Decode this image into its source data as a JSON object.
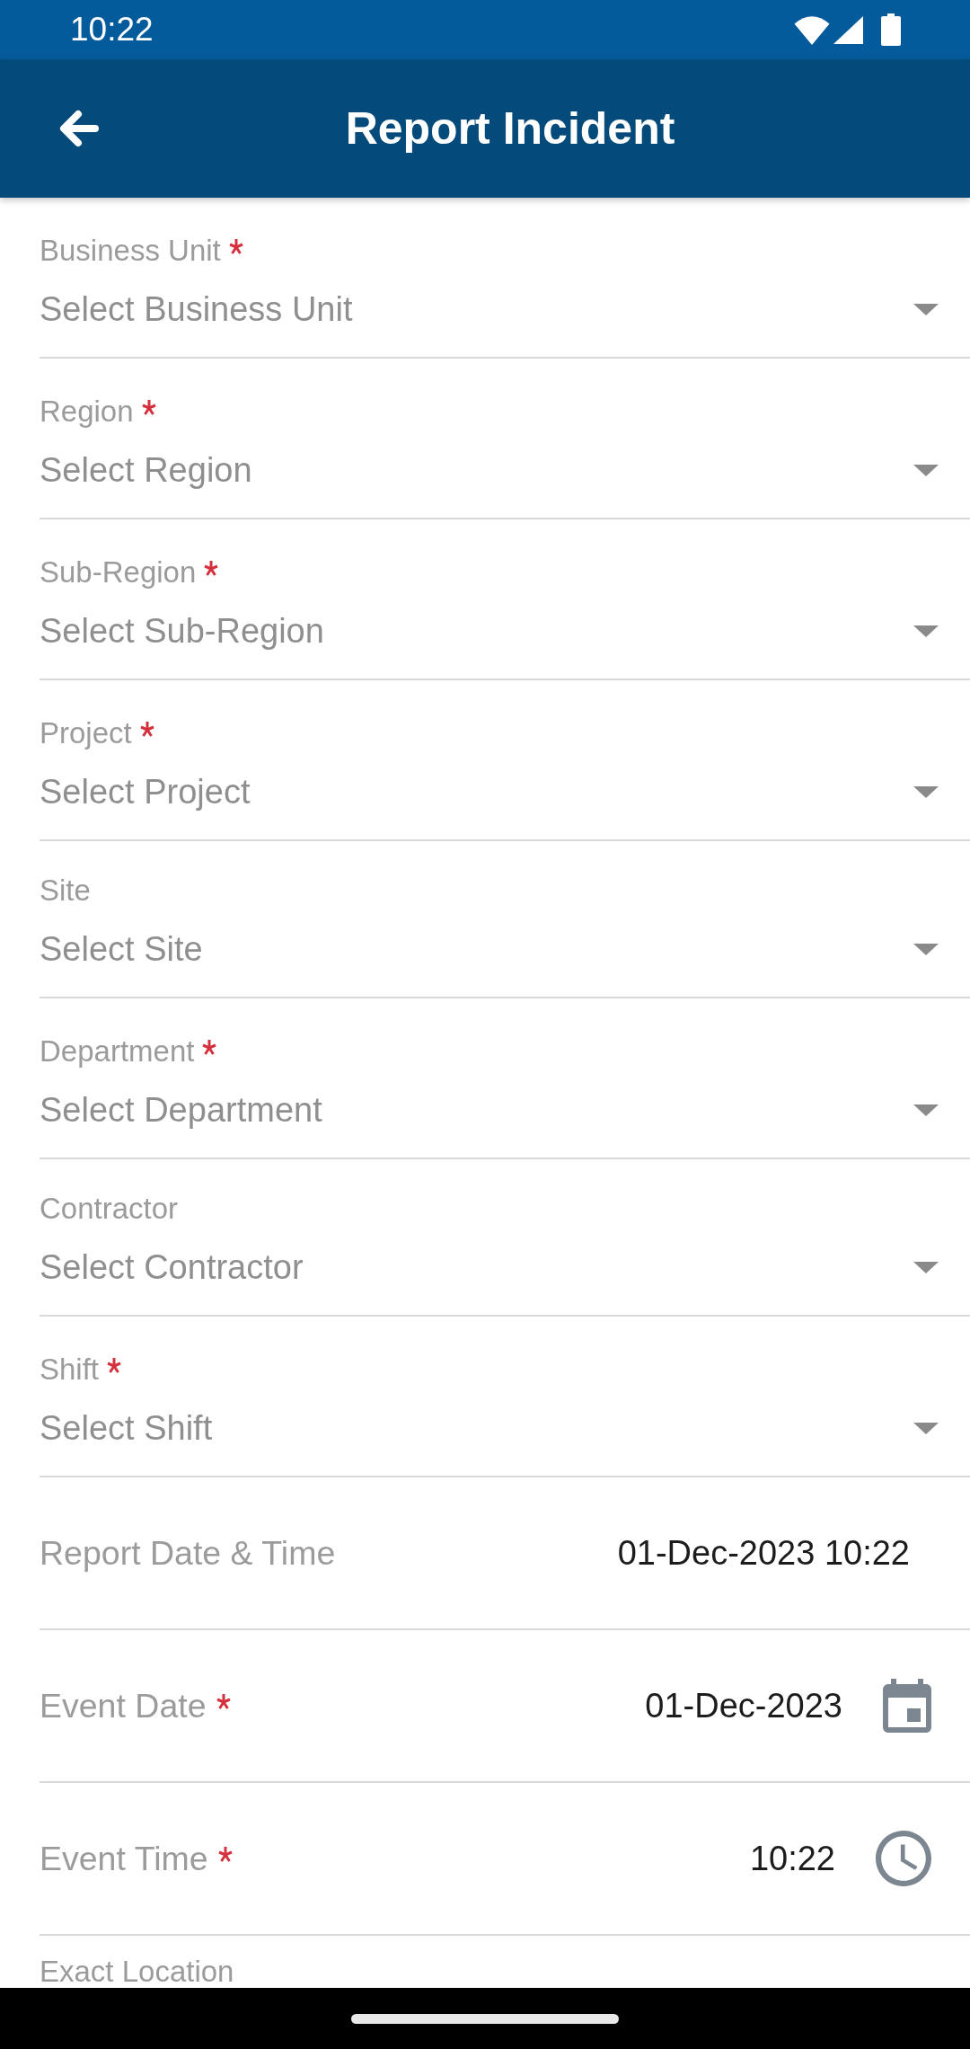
{
  "status_bar": {
    "time": "10:22"
  },
  "app_bar": {
    "title": "Report Incident"
  },
  "form": {
    "fields": [
      {
        "kind": "dropdown",
        "label": "Business Unit",
        "required": true,
        "placeholder": "Select Business Unit"
      },
      {
        "kind": "dropdown",
        "label": "Region",
        "required": true,
        "placeholder": "Select Region"
      },
      {
        "kind": "dropdown",
        "label": "Sub-Region",
        "required": true,
        "placeholder": "Select Sub-Region"
      },
      {
        "kind": "dropdown",
        "label": "Project",
        "required": true,
        "placeholder": "Select Project"
      },
      {
        "kind": "dropdown",
        "label": "Site",
        "required": false,
        "placeholder": "Select Site"
      },
      {
        "kind": "dropdown",
        "label": "Department",
        "required": true,
        "placeholder": "Select Department"
      },
      {
        "kind": "dropdown",
        "label": "Contractor",
        "required": false,
        "placeholder": "Select Contractor"
      },
      {
        "kind": "dropdown",
        "label": "Shift",
        "required": true,
        "placeholder": "Select Shift"
      },
      {
        "kind": "readonly",
        "label": "Report Date & Time",
        "required": false,
        "value": "01-Dec-2023 10:22"
      },
      {
        "kind": "date",
        "label": "Event Date",
        "required": true,
        "value": "01-Dec-2023"
      },
      {
        "kind": "time",
        "label": "Event Time",
        "required": true,
        "value": "10:22"
      },
      {
        "kind": "text",
        "label": "Exact Location",
        "required": false
      }
    ]
  }
}
